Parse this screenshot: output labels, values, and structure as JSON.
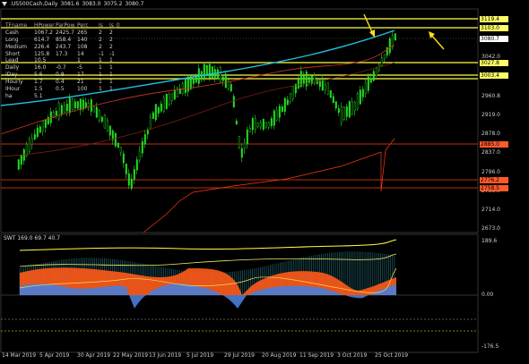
{
  "chart": {
    "symbol_line": ".US500Cash,Daily",
    "ohlc": [
      "3081.6",
      "3083.0",
      "3075.2",
      "3080.7"
    ]
  },
  "trend_table": {
    "headers": [
      "TFname",
      "HPower",
      "ParPow",
      "Perc",
      "Is",
      "Is_0"
    ],
    "rows": [
      [
        "Cash",
        "1067.2",
        "2425.7",
        "265",
        "2",
        "2"
      ],
      [
        "Long",
        "614.7",
        "858.4",
        "140",
        "2",
        "2"
      ],
      [
        "Medium",
        "226.4",
        "243.7",
        "108",
        "2",
        "2"
      ],
      [
        "Short",
        "125.8",
        "17.3",
        "14",
        "-1",
        "-1"
      ],
      [
        "Lead",
        "10.5",
        "",
        "1",
        "1",
        "1"
      ],
      [
        "Daily",
        "16.0",
        "-0.7",
        "-5",
        "1",
        "1"
      ],
      [
        "iDay",
        "5.6",
        "0.8",
        "17",
        "1",
        "1"
      ],
      [
        "Hourly",
        "1.7",
        "0.4",
        "21",
        "1",
        "1"
      ],
      [
        "IHour",
        "1.5",
        "0.5",
        "100",
        "1",
        "1"
      ],
      [
        "ha",
        "5.1",
        "",
        "",
        "",
        ""
      ]
    ]
  },
  "price_axis": {
    "labels": [
      "3042.0",
      "3001.4",
      "2960.8",
      "2919.0",
      "2878.0",
      "2837.0",
      "2796.0",
      "2755.0",
      "2714.0",
      "2673.0"
    ],
    "marked_levels": [
      {
        "label": "3119.4",
        "color": "#ffff66"
      },
      {
        "label": "3103.0",
        "color": "#ffff66"
      },
      {
        "label": "3080.7",
        "color": "#ffffff"
      },
      {
        "label": "3027.8",
        "color": "#ffff66"
      },
      {
        "label": "3003.4",
        "color": "#ffff66"
      },
      {
        "label": "2885.0",
        "color": "#ff5a2a"
      },
      {
        "label": "2776.2",
        "color": "#ff5a2a"
      },
      {
        "label": "2758.5",
        "color": "#ff5a2a"
      }
    ]
  },
  "oscillator": {
    "title": "SWT 169.0 69.7 40.7",
    "axis_labels": [
      "189.6",
      "0.00",
      "-176.5"
    ]
  },
  "dates": [
    "14 Mar 2019",
    "5 Apr 2019",
    "30 Apr 2019",
    "22 May 2019",
    "13 Jun 2019",
    "5 Jul 2019",
    "29 Jul 2019",
    "20 Aug 2019",
    "11 Sep 2019",
    "3 Oct 2019",
    "25 Oct 2019"
  ],
  "colors": {
    "bull_candle": "#22dd22",
    "ma_cyan": "#22c0e0",
    "ma_red": "#c03020",
    "yellow_level": "#ffff44",
    "red_level": "#ff3a1a",
    "osc_orange": "#ff5a1a",
    "osc_blue": "#4a7ed8",
    "arrow": "#ffdd22"
  }
}
